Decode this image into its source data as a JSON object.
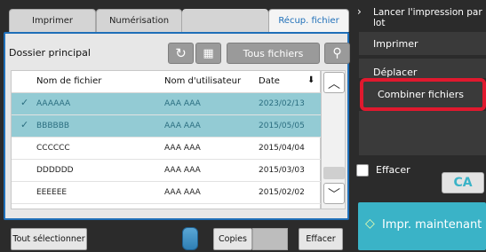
{
  "tabs": [
    "Imprimer",
    "Numérisation",
    "Récup. fichier"
  ],
  "folder_label": "Dossier principal",
  "toolbar": {
    "all_files_label": "Tous fichiers"
  },
  "icons": {
    "refresh": "↻",
    "grid": "▦",
    "search": "⚲",
    "sort_down": "⬇",
    "chevron_up": "︿",
    "chevron_down": "﹀",
    "arrow_right": "›",
    "diamond": "◇"
  },
  "columns": {
    "filename": "Nom de fichier",
    "user": "Nom d'utilisateur",
    "date": "Date"
  },
  "rows": [
    {
      "name": "AAAAAA",
      "user": "AAA AAA",
      "date": "2023/02/13",
      "selected": true
    },
    {
      "name": "BBBBBB",
      "user": "AAA AAA",
      "date": "2015/05/05",
      "selected": true
    },
    {
      "name": "CCCCCC",
      "user": "AAA AAA",
      "date": "2015/04/04",
      "selected": false
    },
    {
      "name": "DDDDDD",
      "user": "AAA AAA",
      "date": "2015/03/03",
      "selected": false
    },
    {
      "name": "EEEEEE",
      "user": "AAA AAA",
      "date": "2015/02/02",
      "selected": false
    }
  ],
  "bottom": {
    "select_all": "Tout sélectionner",
    "copies_label": "Copies",
    "clear_label": "Effacer"
  },
  "right": {
    "batch_print": "Lancer l'impression par lot",
    "print": "Imprimer",
    "move": "Déplacer",
    "combine": "Combiner fichiers",
    "clear_checkbox": "Effacer",
    "ca": "CA",
    "print_now": "Impr. maintenant"
  },
  "colors": {
    "accent": "#1f6fb8",
    "selected_row": "#93cbd4",
    "teal": "#3ab3c7",
    "highlight": "#e0192e"
  }
}
